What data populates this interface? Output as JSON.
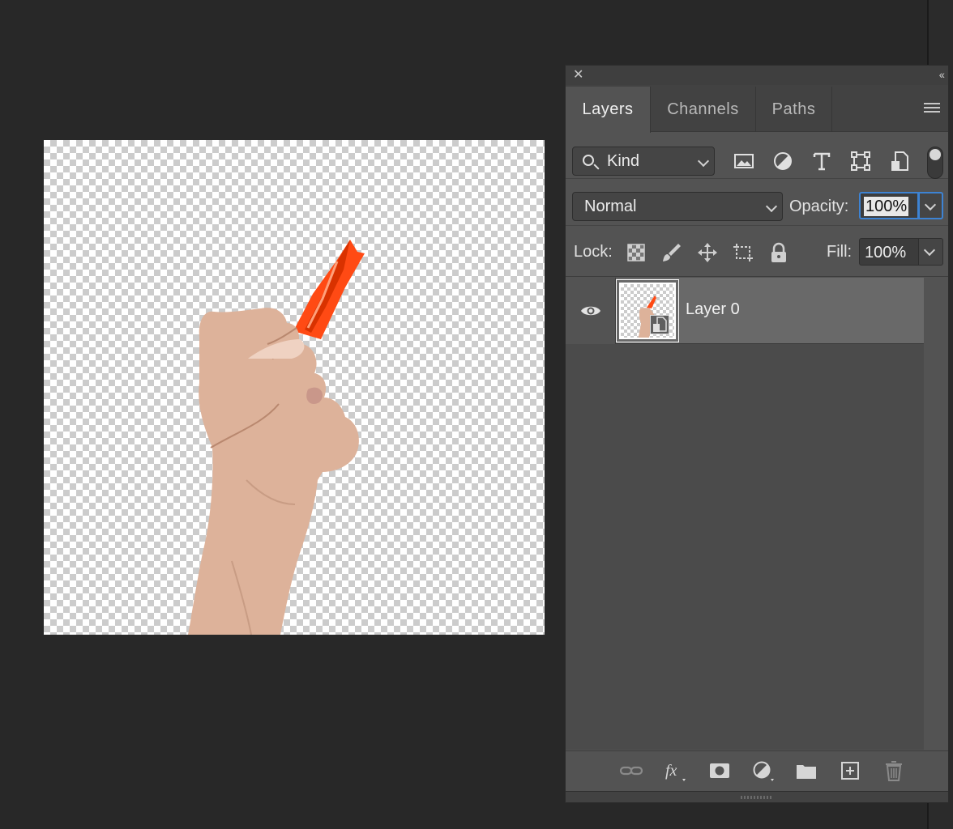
{
  "panel": {
    "tabs": [
      {
        "label": "Layers",
        "active": true
      },
      {
        "label": "Channels",
        "active": false
      },
      {
        "label": "Paths",
        "active": false
      }
    ],
    "filter": {
      "kind_label": "Kind"
    },
    "blend_mode": "Normal",
    "opacity_label": "Opacity:",
    "opacity_value": "100%",
    "lock_label": "Lock:",
    "fill_label": "Fill:",
    "fill_value": "100%",
    "layers": [
      {
        "name": "Layer 0",
        "visible": true,
        "selected": true,
        "smart_object": true
      }
    ],
    "icons": {
      "filter": [
        "image-filter-icon",
        "adjustment-filter-icon",
        "type-filter-icon",
        "shape-filter-icon",
        "smart-object-filter-icon"
      ],
      "lock": [
        "lock-transparent-pixels-icon",
        "lock-image-pixels-icon",
        "lock-position-icon",
        "lock-artboard-icon",
        "lock-all-icon"
      ],
      "bottom": [
        "link-layers-icon",
        "fx-icon",
        "add-mask-icon",
        "new-adjustment-layer-icon",
        "new-group-icon",
        "new-layer-icon",
        "delete-layer-icon"
      ]
    }
  },
  "colors": {
    "accent": "#3d83d3",
    "object": "#ff4a14",
    "panel_bg": "#535353",
    "workspace_bg": "#282828"
  }
}
